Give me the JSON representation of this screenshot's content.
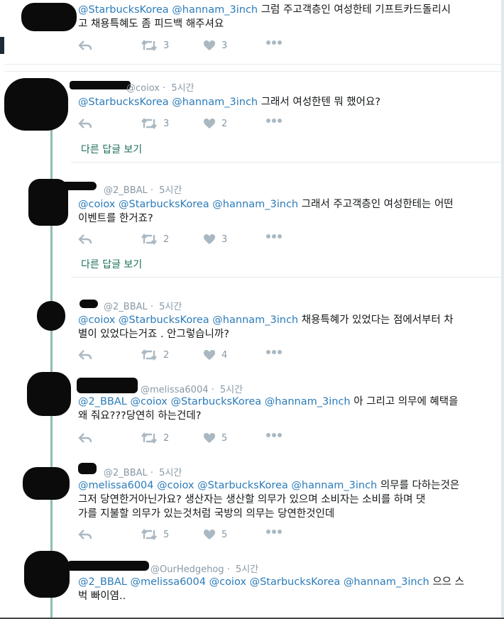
{
  "tweets": [
    {
      "handle": "",
      "time": "",
      "mentions": [
        "@StarbucksKorea",
        "@hannam_3inch"
      ],
      "line1": "그럼 주고객층인 여성한테 기프트카드돌리시",
      "line2": "고 채용특혜도 좀 피드백 해주셔요",
      "retweets": "3",
      "likes": "3"
    },
    {
      "handle": "@coiox",
      "time": "5시간",
      "mentions": [
        "@StarbucksKorea",
        "@hannam_3inch"
      ],
      "line1": "그래서 여성한텐 뭐 했어요?",
      "line2": "",
      "retweets": "3",
      "likes": "2"
    },
    {
      "handle": "@2_BBAL",
      "time": "5시간",
      "mentions": [
        "@coiox",
        "@StarbucksKorea",
        "@hannam_3inch"
      ],
      "line1": "그래서 주고객층인 여성한테는 어떤",
      "line2": "이벤트를 한거죠?",
      "retweets": "2",
      "likes": "3"
    },
    {
      "handle": "@2_BBAL",
      "time": "5시간",
      "mentions": [
        "@coiox",
        "@StarbucksKorea",
        "@hannam_3inch"
      ],
      "line1": "채용특혜가 있었다는 점에서부터 차",
      "line2": "별이 있었다는거죠 . 안그렇습니까?",
      "retweets": "2",
      "likes": "4"
    },
    {
      "handle": "@melissa6004",
      "time": "5시간",
      "mentions": [
        "@2_BBAL",
        "@coiox",
        "@StarbucksKorea",
        "@hannam_3inch"
      ],
      "line1": "아 그리고 의무에 혜택을",
      "line2": "왜 줘요???당연히 하는건데?",
      "retweets": "2",
      "likes": "5"
    },
    {
      "handle": "@2_BBAL",
      "time": "5시간",
      "mentions": [
        "@melissa6004",
        "@coiox",
        "@StarbucksKorea",
        "@hannam_3inch"
      ],
      "line1": "의무를 다하는것은",
      "line2": "그저 당연한거아닌가요? 생산자는 생산할 의무가 있으며 소비자는 소비를 하며 댓",
      "line3": "가를 지불할 의무가 있는것처럼 국방의 의무는 당연한것인데",
      "retweets": "5",
      "likes": "5"
    },
    {
      "handle": "@OurHedgehog",
      "time": "5시간",
      "mentions": [
        "@2_BBAL",
        "@melissa6004",
        "@coiox",
        "@StarbucksKorea",
        "@hannam_3inch"
      ],
      "line1": "으으 스",
      "line2": "벅 빠이염..",
      "retweets": "",
      "likes": ""
    }
  ],
  "more_replies_label": "다른 답글 보기",
  "colors": {
    "mention": "#2b7bb9",
    "muted": "#8899a6",
    "icon": "#aab8c2",
    "thread_line": "#8fbfae",
    "more_link": "#1b6e5a"
  },
  "icons": [
    "reply-icon",
    "retweet-icon",
    "like-icon",
    "more-icon"
  ]
}
